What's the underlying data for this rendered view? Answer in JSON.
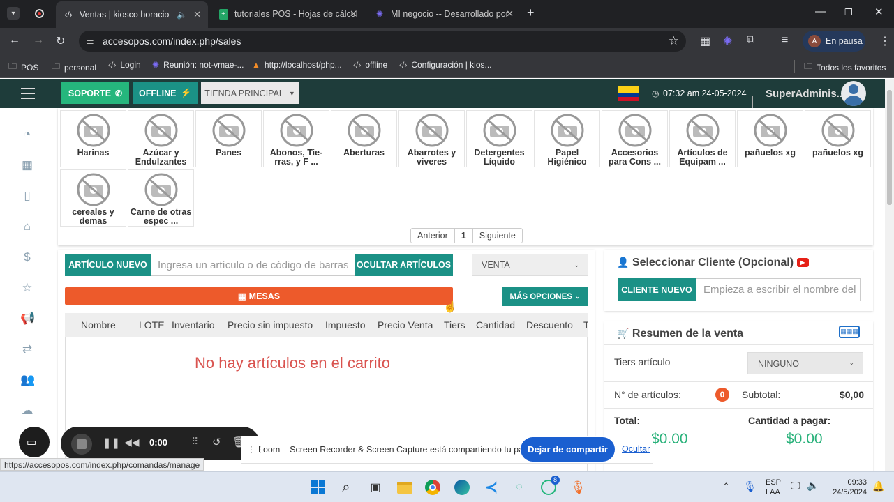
{
  "browser": {
    "tabs": [
      {
        "title": "Ventas | kiosco horacio",
        "active": true
      },
      {
        "title": "tutoriales POS - Hojas de cálcul",
        "active": false
      },
      {
        "title": "MI negocio -- Desarrollado por",
        "active": false
      }
    ],
    "url": "accesopos.com/index.php/sales",
    "profile_initial": "A",
    "profile_label": "En pausa",
    "bookmarks": [
      "POS",
      "personal",
      "Login",
      "Reunión: not-vmae-...",
      "http://localhost/php...",
      "offline",
      "Configuración | kios..."
    ],
    "all_bookmarks": "Todos los favoritos"
  },
  "header": {
    "support": "SOPORTE",
    "offline": "OFFLINE",
    "store": "TIENDA PRINCIPAL",
    "datetime": "07:32 am 24-05-2024",
    "user": "SuperAdminis..."
  },
  "categories": [
    {
      "line1": "Harinas",
      "line2": ""
    },
    {
      "line1": "Azúcar y",
      "line2": "Endulzantes"
    },
    {
      "line1": "Panes",
      "line2": ""
    },
    {
      "line1": "Abonos, Tie-",
      "line2": "rras, y F ..."
    },
    {
      "line1": "Aberturas",
      "line2": ""
    },
    {
      "line1": "Abarrotes y",
      "line2": "viveres"
    },
    {
      "line1": "Detergentes",
      "line2": "Líquido"
    },
    {
      "line1": "Papel Higiénico",
      "line2": ""
    },
    {
      "line1": "Accesorios",
      "line2": "para Cons ..."
    },
    {
      "line1": "Artículos de",
      "line2": "Equipam ..."
    },
    {
      "line1": "pañuelos xg",
      "line2": ""
    },
    {
      "line1": "pañuelos xg",
      "line2": ""
    },
    {
      "line1": "cereales y",
      "line2": "demas"
    },
    {
      "line1": "Carne de otras",
      "line2": "espec ..."
    }
  ],
  "pager": {
    "prev": "Anterior",
    "page": "1",
    "next": "Siguiente"
  },
  "cart": {
    "new_item": "ARTÍCULO NUEVO",
    "search_placeholder": "Ingresa un artículo o de código de barras",
    "hide_items": "OCULTAR ARTÍCULOS",
    "mode": "VENTA",
    "mesas": "MESAS",
    "more_options": "MÁS OPCIONES",
    "columns": [
      "Nombre",
      "LOTE",
      "Inventario",
      "Precio sin impuesto",
      "Impuesto",
      "Precio Venta",
      "Tiers",
      "Cantidad",
      "Descuento",
      "T"
    ],
    "empty": "No hay artículos en el carrito"
  },
  "client": {
    "title": "Seleccionar Cliente (Opcional)",
    "new_client": "CLIENTE NUEVO",
    "search_placeholder": "Empieza a escribir el nombre del"
  },
  "summary": {
    "title": "Resumen de la venta",
    "tiers_label": "Tiers artículo",
    "tiers_value": "NINGUNO",
    "items_label": "N° de artículos:",
    "items_count": "0",
    "subtotal_label": "Subtotal:",
    "subtotal_value": "$0,00",
    "total_label": "Total:",
    "total_value": "$0.00",
    "pay_label": "Cantidad a pagar:",
    "pay_value": "$0.00"
  },
  "loom": {
    "timer": "0:00",
    "share_text": "Loom – Screen Recorder & Screen Capture está compartiendo tu pantalla.",
    "stop_share": "Dejar de compartir",
    "hide": "Ocultar"
  },
  "status_url": "https://accesopos.com/index.php/comandas/manage",
  "taskbar": {
    "lang1": "ESP",
    "lang2": "LAA",
    "time": "09:33",
    "date": "24/5/2024",
    "whatsapp_badge": "8"
  },
  "colors": {
    "teal": "#1b9186",
    "orange": "#ed5a2b",
    "header": "#1e3c3a",
    "empty_red": "#d9534f",
    "total_green": "#2ab27b"
  }
}
